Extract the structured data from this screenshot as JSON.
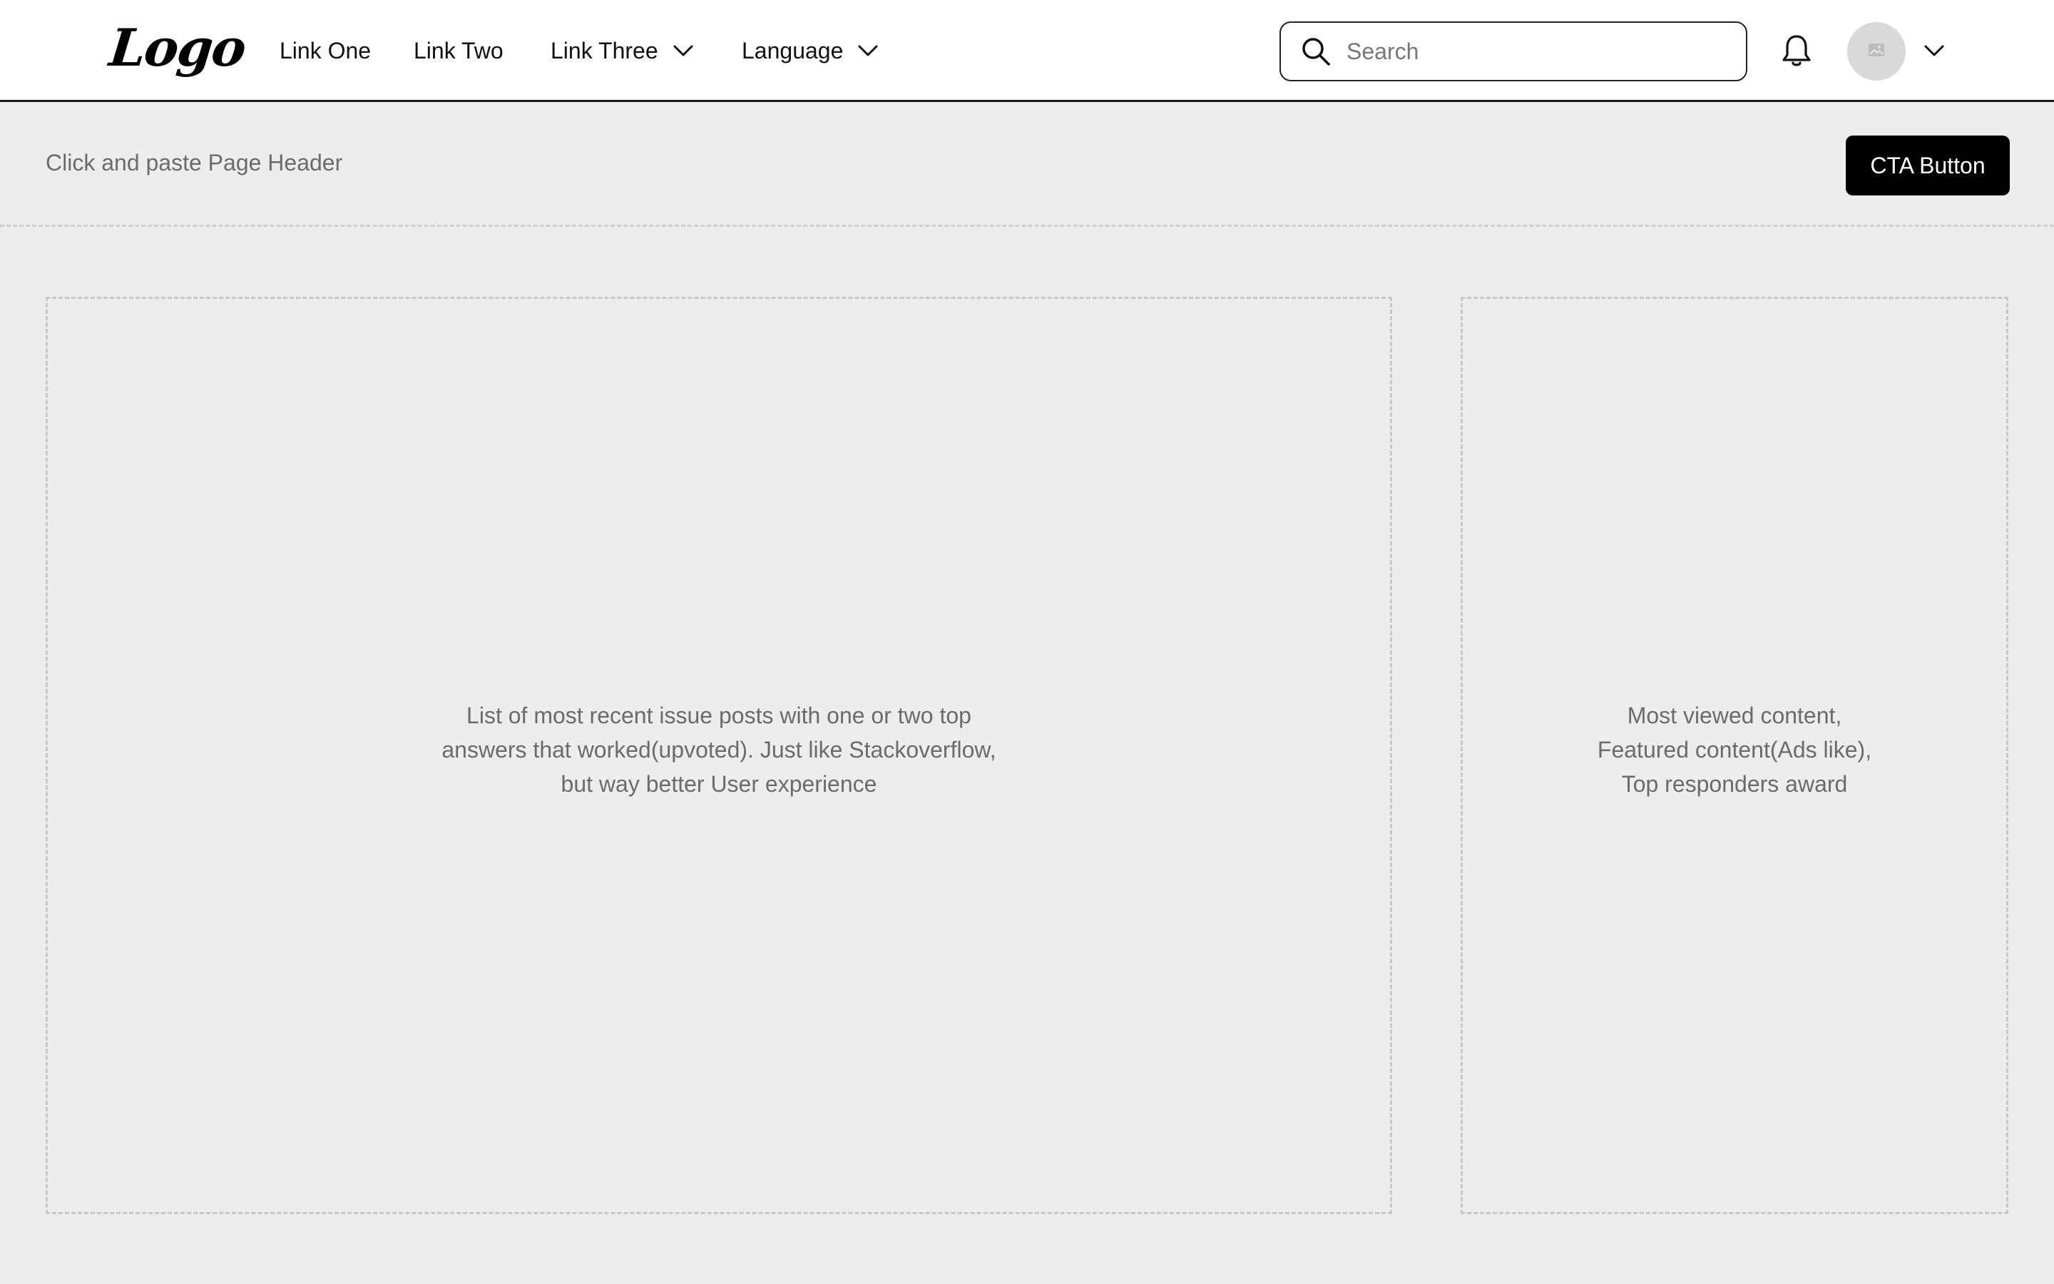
{
  "nav": {
    "logo_text": "Logo",
    "links": [
      {
        "label": "Link One"
      },
      {
        "label": "Link Two"
      },
      {
        "label": "Link Three",
        "has_dropdown": true
      },
      {
        "label": "Language",
        "has_dropdown": true
      }
    ],
    "search": {
      "placeholder": "Search",
      "value": ""
    },
    "notification_icon": "bell-icon",
    "avatar_icon": "image-placeholder-icon"
  },
  "page_header": {
    "title": "Click and paste Page Header",
    "cta_label": "CTA Button"
  },
  "main_panel": {
    "text": "List of most recent issue posts with one or two top\nanswers that worked(upvoted). Just like Stackoverflow,\nbut way better User experience"
  },
  "side_panel": {
    "text": "Most viewed content,\nFeatured content(Ads like),\nTop responders award"
  },
  "colors": {
    "page_background": "#ededed",
    "nav_background": "#ffffff",
    "cta_background": "#000000",
    "cta_text": "#ffffff",
    "muted_text": "#6b6b6b",
    "dashed_border": "#c8c8c8",
    "avatar_background": "#d9d9d9"
  }
}
